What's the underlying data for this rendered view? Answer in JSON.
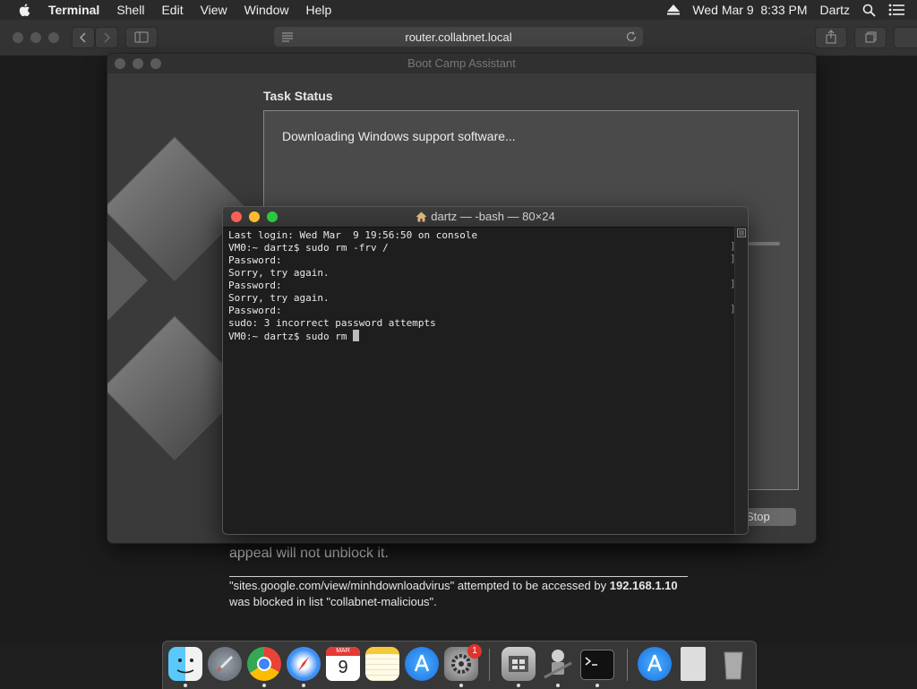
{
  "menubar": {
    "app_name": "Terminal",
    "items": [
      "Shell",
      "Edit",
      "View",
      "Window",
      "Help"
    ],
    "clock": "Wed Mar 9  8:33 PM",
    "user": "Dartz"
  },
  "safari": {
    "url": "router.collabnet.local"
  },
  "page": {
    "appeal_text": "appeal will not unblock it.",
    "blocked_line1_a": "\"sites.google.com/view/minhdownloadvirus\" attempted to be accessed by ",
    "blocked_line1_ip": "192.168.1.10",
    "blocked_line2": "was blocked in list \"collabnet-malicious\"."
  },
  "bootcamp": {
    "title": "Boot Camp Assistant",
    "heading": "Task Status",
    "status": "Downloading Windows support software...",
    "stop_label": "Stop"
  },
  "terminal": {
    "title": "dartz — -bash — 80×24",
    "lines": [
      "Last login: Wed Mar  9 19:56:50 on console",
      "VM0:~ dartz$ sudo rm -frv /",
      "Password:",
      "Sorry, try again.",
      "Password:",
      "Sorry, try again.",
      "Password:",
      "sudo: 3 incorrect password attempts"
    ],
    "prompt_line": "VM0:~ dartz$ sudo rm "
  },
  "dock": {
    "apps": [
      "Finder",
      "Launchpad",
      "Google Chrome",
      "Safari",
      "Calendar",
      "Notes",
      "App Store",
      "System Preferences",
      "Boot Camp Assistant",
      "Automator",
      "Terminal",
      "App Store Downloads",
      "Documents",
      "Trash"
    ],
    "calendar_month": "MAR",
    "calendar_day": "9",
    "prefs_badge": "1"
  }
}
